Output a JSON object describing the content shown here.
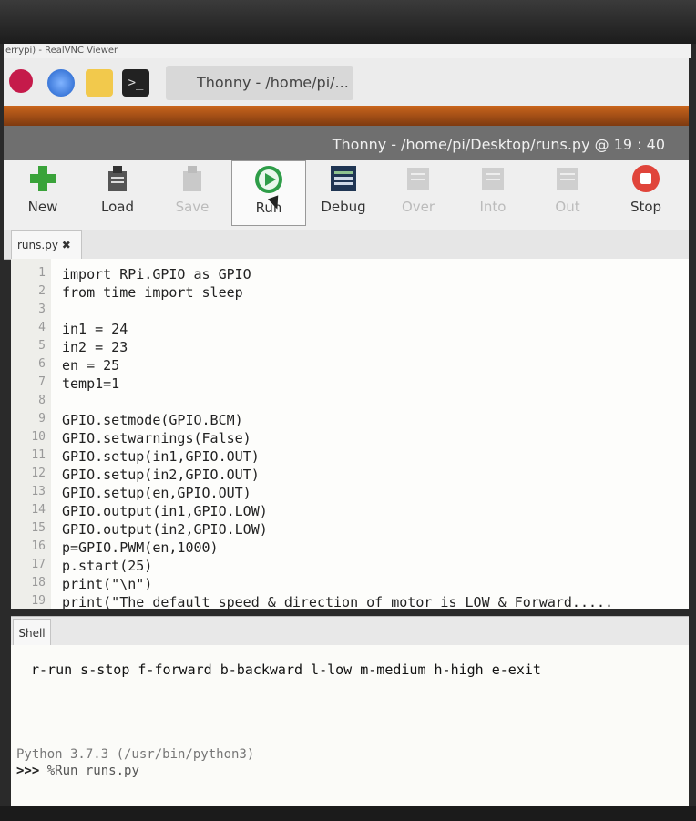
{
  "vnc_title": "errypi) - RealVNC Viewer",
  "taskbar": {
    "window_label": "Thonny - /home/pi/..."
  },
  "window_title": "Thonny - /home/pi/Desktop/runs.py @ 19 : 40",
  "toolbar": {
    "new": "New",
    "load": "Load",
    "save": "Save",
    "run": "Run",
    "debug": "Debug",
    "over": "Over",
    "into": "Into",
    "out": "Out",
    "stop": "Stop"
  },
  "tab": {
    "label": "runs.py ✖"
  },
  "editor": {
    "line_numbers": [
      "1",
      "2",
      "3",
      "4",
      "5",
      "6",
      "7",
      "8",
      "9",
      "10",
      "11",
      "12",
      "13",
      "14",
      "15",
      "16",
      "17",
      "18",
      "19"
    ],
    "lines": [
      "import RPi.GPIO as GPIO",
      "from time import sleep",
      "",
      "in1 = 24",
      "in2 = 23",
      "en = 25",
      "temp1=1",
      "",
      "GPIO.setmode(GPIO.BCM)",
      "GPIO.setwarnings(False)",
      "GPIO.setup(in1,GPIO.OUT)",
      "GPIO.setup(in2,GPIO.OUT)",
      "GPIO.setup(en,GPIO.OUT)",
      "GPIO.output(in1,GPIO.LOW)",
      "GPIO.output(in2,GPIO.LOW)",
      "p=GPIO.PWM(en,1000)",
      "p.start(25)",
      "print(\"\\n\")",
      "print(\"The default speed & direction of motor is LOW & Forward....."
    ]
  },
  "shell": {
    "tab": "Shell",
    "output": "r-run s-stop f-forward b-backward l-low m-medium h-high e-exit",
    "version": "Python 3.7.3 (/usr/bin/python3)",
    "prompt": ">>>",
    "command": "%Run runs.py"
  }
}
